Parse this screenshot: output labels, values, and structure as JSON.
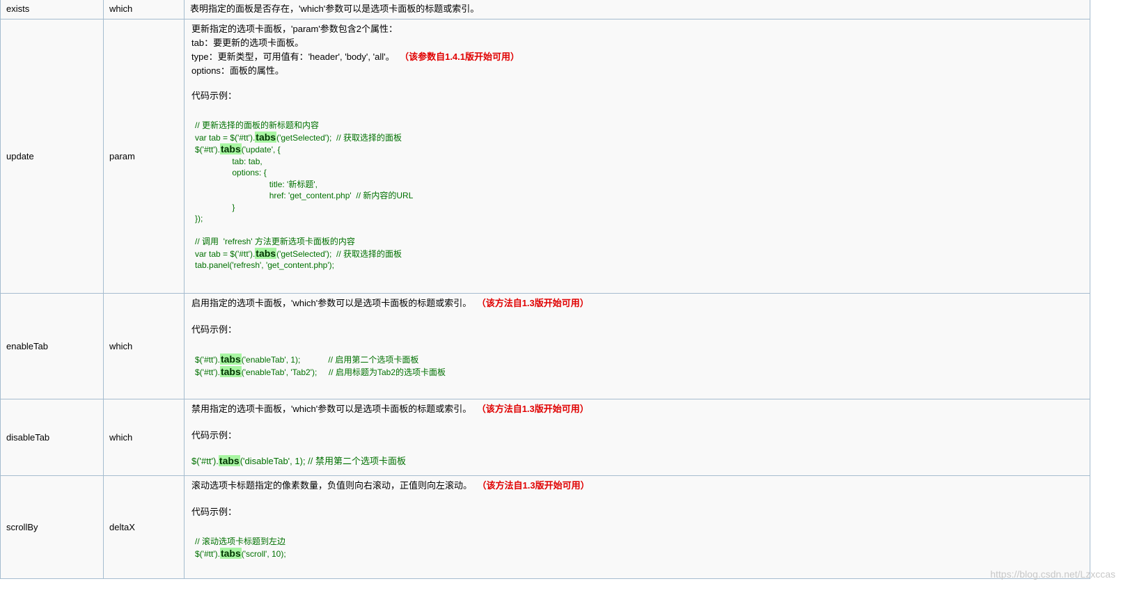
{
  "rows": {
    "exists": {
      "name": "exists",
      "param": "which",
      "desc": "表明指定的面板是否存在，'which'参数可以是选项卡面板的标题或索引。"
    },
    "update": {
      "name": "update",
      "param": "param",
      "desc_lines": [
        "更新指定的选项卡面板，'param'参数包含2个属性：",
        "tab：要更新的选项卡面板。",
        "type：更新类型，可用值有：'header', 'body', 'all'。",
        "options：面板的属性。"
      ],
      "note": "（该参数自1.4.1版开始可用）",
      "example_label": "代码示例：",
      "code": {
        "c1": "// 更新选择的面板的新标题和内容",
        "l2a": "var tab = $('#tt').",
        "l2b": "('getSelected');  // 获取选择的面板",
        "l3a": "$('#tt').",
        "l3b": "('update', {",
        "l4": "                tab: tab,",
        "l5": "                options: {",
        "l6": "                                title: '新标题',",
        "l7": "                                href: 'get_content.php'  // 新内容的URL",
        "l8": "                }",
        "l9": "});",
        "c2": "// 调用  'refresh' 方法更新选项卡面板的内容",
        "l11a": "var tab = $('#tt').",
        "l11b": "('getSelected');  // 获取选择的面板",
        "l12": "tab.panel('refresh', 'get_content.php');"
      }
    },
    "enableTab": {
      "name": "enableTab",
      "param": "which",
      "desc": "启用指定的选项卡面板，'which'参数可以是选项卡面板的标题或索引。",
      "note": "（该方法自1.3版开始可用）",
      "example_label": "代码示例：",
      "code": {
        "l1a": "$('#tt').",
        "l1b": "('enableTab', 1);            // 启用第二个选项卡面板",
        "l2a": "$('#tt').",
        "l2b": "('enableTab', 'Tab2');     // 启用标题为Tab2的选项卡面板"
      }
    },
    "disableTab": {
      "name": "disableTab",
      "param": "which",
      "desc": "禁用指定的选项卡面板，'which'参数可以是选项卡面板的标题或索引。",
      "note": "（该方法自1.3版开始可用）",
      "example_label": "代码示例：",
      "code": {
        "l1a": "$('#tt').",
        "l1b": "('disableTab', 1); // 禁用第二个选项卡面板"
      }
    },
    "scrollBy": {
      "name": "scrollBy",
      "param": "deltaX",
      "desc": "滚动选项卡标题指定的像素数量，负值则向右滚动，正值则向左滚动。",
      "note": "（该方法自1.3版开始可用）",
      "example_label": "代码示例：",
      "code": {
        "c1": "// 滚动选项卡标题到左边",
        "l2a": "$('#tt').",
        "l2b": "('scroll', 10);"
      }
    }
  },
  "keyword": "tabs",
  "watermark": "https://blog.csdn.net/Lzxccas",
  "colors": {
    "border": "#a5bccf",
    "code": "#007000",
    "note": "#e00000",
    "highlight": "#a8f5a2",
    "cell_bg": "#f9f9f9"
  }
}
